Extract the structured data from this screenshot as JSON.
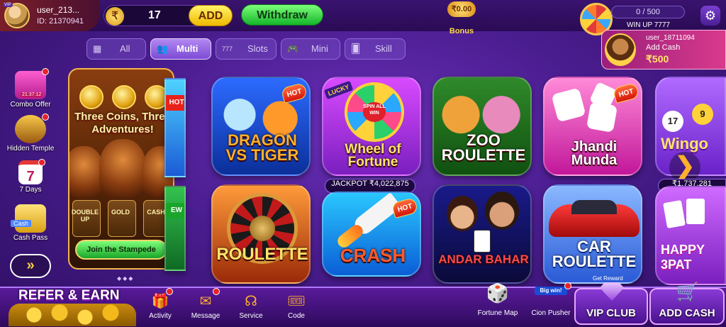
{
  "header": {
    "username": "user_213...",
    "user_id": "ID: 21370941",
    "vip_tag": "VIP",
    "balance": "17",
    "currency_symbol": "₹",
    "add_label": "ADD",
    "withdraw_label": "Withdraw",
    "bonus_amount": "₹0.00",
    "bonus_label": "Bonus",
    "vip_progress": "0 / 500",
    "win_up": "WIN UP 7777",
    "settings_icon": "gear-icon"
  },
  "user_card": {
    "user": "user_18711094",
    "action": "Add Cash",
    "amount": "₹500"
  },
  "tabs": [
    {
      "label": "All",
      "icon": "grid-icon",
      "active": false
    },
    {
      "label": "Multi",
      "icon": "users-icon",
      "active": true
    },
    {
      "label": "Slots",
      "icon": "slot-777-icon",
      "active": false
    },
    {
      "label": "Mini",
      "icon": "gamepad-icon",
      "active": false
    },
    {
      "label": "Skill",
      "icon": "skill-cards-icon",
      "active": false
    }
  ],
  "sidebar": [
    {
      "label": "Combo Offer",
      "icon": "gift-box-icon",
      "timer": "21:37:12"
    },
    {
      "label": "Hidden Temple",
      "icon": "treasure-chest-icon"
    },
    {
      "label": "7 Days",
      "icon": "calendar-7-icon",
      "icon_text": "7"
    },
    {
      "label": "Cash Pass",
      "icon": "coin-stack-icon",
      "icon_text": "Cash"
    }
  ],
  "promo": {
    "title": "Three Coins, Three Adventures!",
    "words": [
      "DOUBLE UP",
      "GOLD",
      "CASH"
    ],
    "button": "Join the Stampede"
  },
  "games_row1": [
    {
      "name": "DRAGON VS TIGER",
      "hot": true
    },
    {
      "name": "Wheel of Fortune",
      "badge": "LUCKY",
      "wheel_text": "SPIN ALL WIN"
    },
    {
      "name": "ZOO ROULETTE"
    },
    {
      "name": "Jhandi Munda",
      "hot": true
    },
    {
      "name": "Wingo",
      "partial": true,
      "balls": [
        "17",
        "9"
      ]
    }
  ],
  "games_row2": [
    {
      "name": "ROULETTE"
    },
    {
      "name": "CRASH",
      "hot": true,
      "jackpot": "JACKPOT ₹4,022,875"
    },
    {
      "name": "ANDAR BAHAR"
    },
    {
      "name": "CAR ROULETTE"
    },
    {
      "name": "HAPPY 3PAT",
      "partial": true,
      "jackpot": "₹1,737,281"
    }
  ],
  "partial_badges": {
    "hot": "HOT",
    "new": "EW"
  },
  "bottom": {
    "refer": "REFER & EARN",
    "nav": [
      {
        "label": "Activity",
        "icon": "gift-icon"
      },
      {
        "label": "Message",
        "icon": "envelope-icon"
      },
      {
        "label": "Service",
        "icon": "headset-icon"
      },
      {
        "label": "Code",
        "icon": "ticket-icon"
      }
    ],
    "fortune_map": "Fortune Map",
    "coin_pusher": "Cion Pusher",
    "coin_pusher_badge": "Big win!",
    "get_reward": "Get Reward",
    "vip_club": "VIP CLUB",
    "add_cash": "ADD CASH"
  }
}
